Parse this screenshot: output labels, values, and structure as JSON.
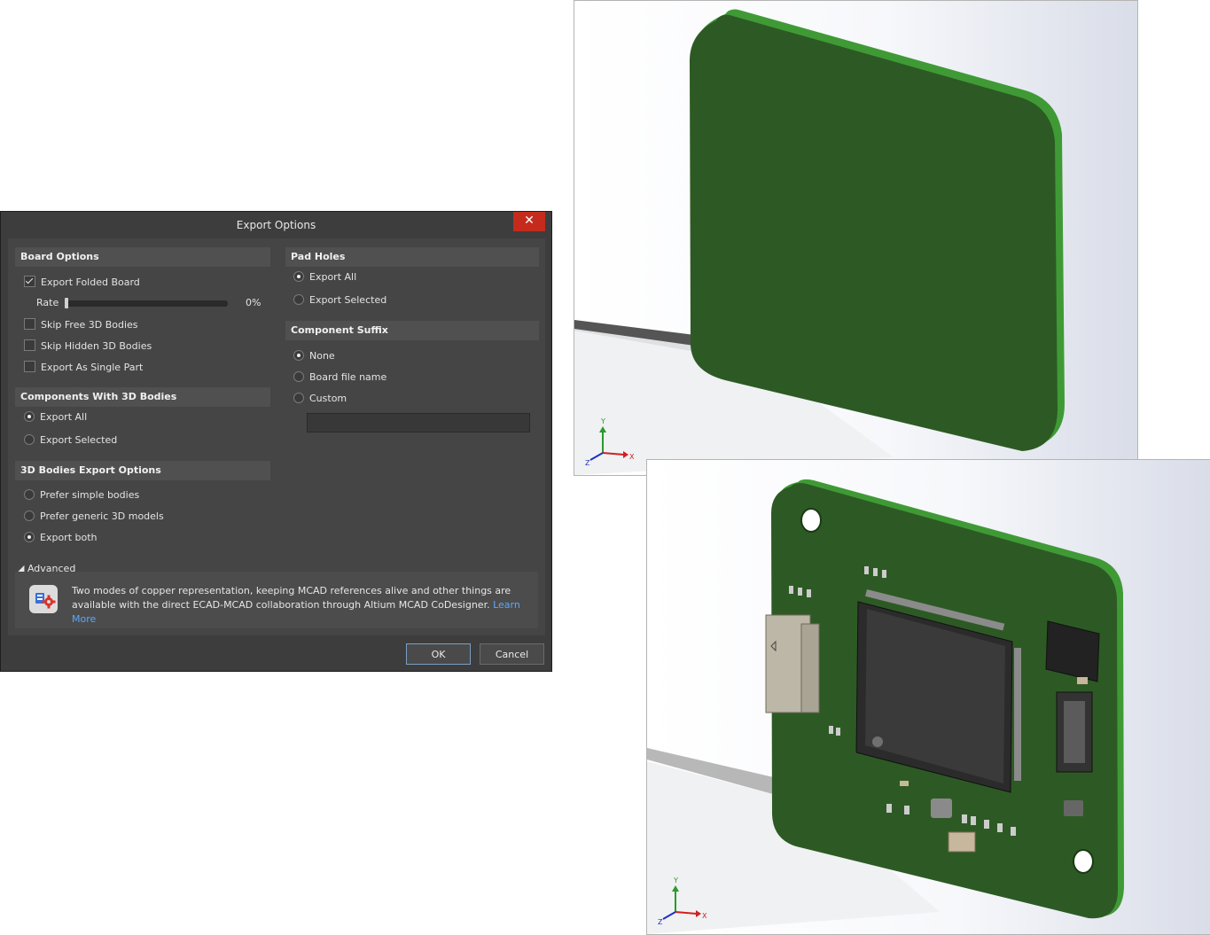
{
  "dialog": {
    "title": "Export Options",
    "close_label": "✕",
    "board_options": {
      "header": "Board Options",
      "export_folded_board": {
        "label": "Export Folded Board",
        "checked": true
      },
      "rate_label": "Rate",
      "rate_value": "0%",
      "rate_fraction": 0.0,
      "skip_free": {
        "label": "Skip Free 3D Bodies",
        "checked": false
      },
      "skip_hidden": {
        "label": "Skip Hidden 3D Bodies",
        "checked": false
      },
      "single_part": {
        "label": "Export As Single Part",
        "checked": false
      }
    },
    "components_3d": {
      "header": "Components With 3D Bodies",
      "options": [
        "Export All",
        "Export Selected"
      ],
      "selected": "Export All"
    },
    "bodies_export": {
      "header": "3D Bodies Export Options",
      "options": [
        "Prefer simple bodies",
        "Prefer generic 3D models",
        "Export both"
      ],
      "selected": "Export both"
    },
    "pad_holes": {
      "header": "Pad Holes",
      "options": [
        "Export All",
        "Export Selected"
      ],
      "selected": "Export All"
    },
    "component_suffix": {
      "header": "Component Suffix",
      "options": [
        "None",
        "Board file name",
        "Custom"
      ],
      "selected": "None",
      "custom_value": ""
    },
    "advanced_label": "Advanced",
    "info_text": "Two modes of copper representation, keeping MCAD references alive and other things are available with the direct ECAD-MCAD collaboration through Altium MCAD CoDesigner.",
    "learn_more": "Learn More",
    "ok_label": "OK",
    "cancel_label": "Cancel"
  },
  "viewport_top": {
    "axis_x": "X",
    "axis_y": "Y",
    "axis_z": "Z"
  },
  "viewport_bottom": {
    "axis_x": "X",
    "axis_y": "Y",
    "axis_z": "Z"
  },
  "colors": {
    "board_green": "#2d5a24",
    "board_edge": "#3f9a36",
    "dialog_bg": "#3d3d3d",
    "close_red": "#c42b1c",
    "link": "#5aa7ff"
  }
}
